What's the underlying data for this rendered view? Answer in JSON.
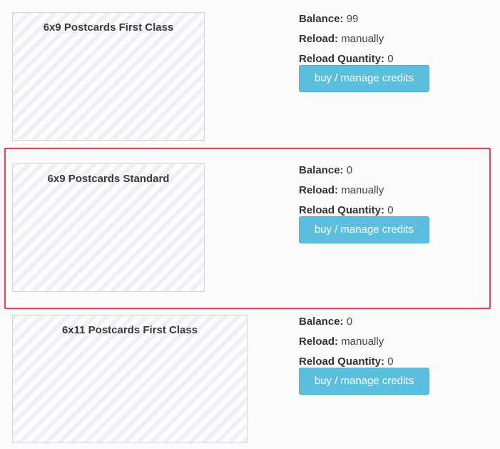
{
  "products": [
    {
      "title": "6x9 Postcards First Class",
      "balance_label": "Balance:",
      "balance_value": "99",
      "reload_label": "Reload:",
      "reload_value": "manually",
      "reload_qty_label": "Reload Quantity:",
      "reload_qty_value": "0",
      "button_label": "buy / manage credits"
    },
    {
      "title": "6x9 Postcards Standard",
      "balance_label": "Balance:",
      "balance_value": "0",
      "reload_label": "Reload:",
      "reload_value": "manually",
      "reload_qty_label": "Reload Quantity:",
      "reload_qty_value": "0",
      "button_label": "buy / manage credits"
    },
    {
      "title": "6x11 Postcards First Class",
      "balance_label": "Balance:",
      "balance_value": "0",
      "reload_label": "Reload:",
      "reload_value": "manually",
      "reload_qty_label": "Reload Quantity:",
      "reload_qty_value": "0",
      "button_label": "buy / manage credits"
    }
  ],
  "colors": {
    "button_bg": "#5bc0de",
    "highlight_border": "#e0474b"
  }
}
